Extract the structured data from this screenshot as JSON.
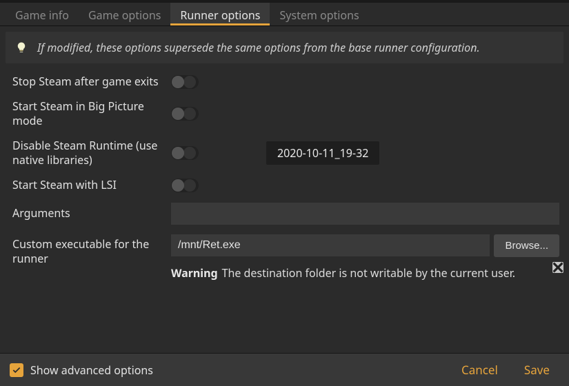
{
  "tabs": {
    "game_info": "Game info",
    "game_options": "Game options",
    "runner_options": "Runner options",
    "system_options": "System options"
  },
  "banner": {
    "text": "If modified, these options supersede the same options from the base runner configuration."
  },
  "options": {
    "stop_steam": {
      "label": "Stop Steam after game exits"
    },
    "big_picture": {
      "label": "Start Steam in Big Picture mode"
    },
    "disable_runtime": {
      "label": "Disable Steam Runtime (use native libraries)",
      "tooltip": "2020-10-11_19-32"
    },
    "lsi": {
      "label": "Start Steam with LSI"
    },
    "arguments": {
      "label": "Arguments",
      "value": ""
    },
    "custom_exec": {
      "label": "Custom executable for the runner",
      "value": "/mnt/Ret.exe",
      "browse": "Browse...",
      "warning_prefix": "Warning",
      "warning_text": "The destination folder is not writable by the current user."
    }
  },
  "footer": {
    "advanced": "Show advanced options",
    "cancel": "Cancel",
    "save": "Save"
  }
}
